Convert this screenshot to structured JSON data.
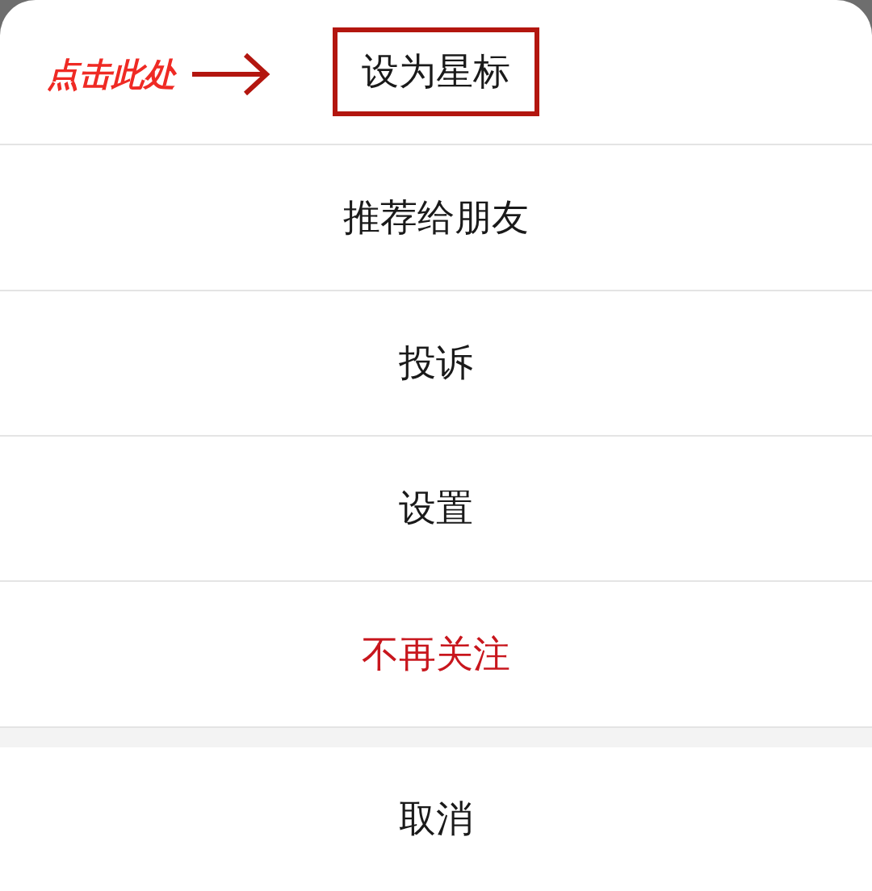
{
  "annotation": {
    "label": "点击此处"
  },
  "items": [
    {
      "label": "设为星标",
      "kind": "normal",
      "highlighted": true
    },
    {
      "label": "推荐给朋友",
      "kind": "normal",
      "highlighted": false
    },
    {
      "label": "投诉",
      "kind": "normal",
      "highlighted": false
    },
    {
      "label": "设置",
      "kind": "normal",
      "highlighted": false
    },
    {
      "label": "不再关注",
      "kind": "danger",
      "highlighted": false
    }
  ],
  "cancel": {
    "label": "取消"
  }
}
